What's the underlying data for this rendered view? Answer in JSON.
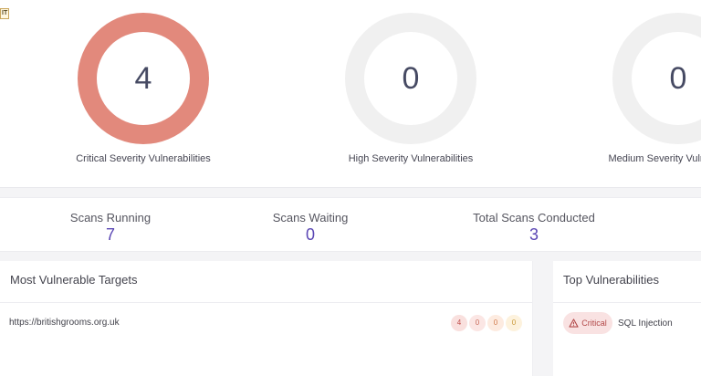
{
  "badge": "IT",
  "severity_summary": [
    {
      "label": "Critical Severity Vulnerabilities",
      "count": "4",
      "ring_color": "#e2897c"
    },
    {
      "label": "High Severity Vulnerabilities",
      "count": "0",
      "ring_color": "#f0f0f0"
    },
    {
      "label": "Medium Severity Vulnerabilities",
      "count": "0",
      "ring_color": "#f0f0f0"
    }
  ],
  "stats": [
    {
      "label": "Scans Running",
      "value": "7"
    },
    {
      "label": "Scans Waiting",
      "value": "0"
    },
    {
      "label": "Total Scans Conducted",
      "value": "3"
    }
  ],
  "most_vulnerable_targets": {
    "title": "Most Vulnerable Targets",
    "rows": [
      {
        "url": "https://britishgrooms.org.uk",
        "counts": [
          {
            "value": "4",
            "bg": "#f9e0de",
            "color": "#c0504d"
          },
          {
            "value": "0",
            "bg": "#fbe6e4",
            "color": "#c86a5a"
          },
          {
            "value": "0",
            "bg": "#fdebe0",
            "color": "#d07a4a"
          },
          {
            "value": "0",
            "bg": "#fdf2dd",
            "color": "#c99a3a"
          }
        ]
      }
    ]
  },
  "top_vulnerabilities": {
    "title": "Top Vulnerabilities",
    "rows": [
      {
        "severity": "Critical",
        "name": "SQL Injection"
      }
    ]
  }
}
